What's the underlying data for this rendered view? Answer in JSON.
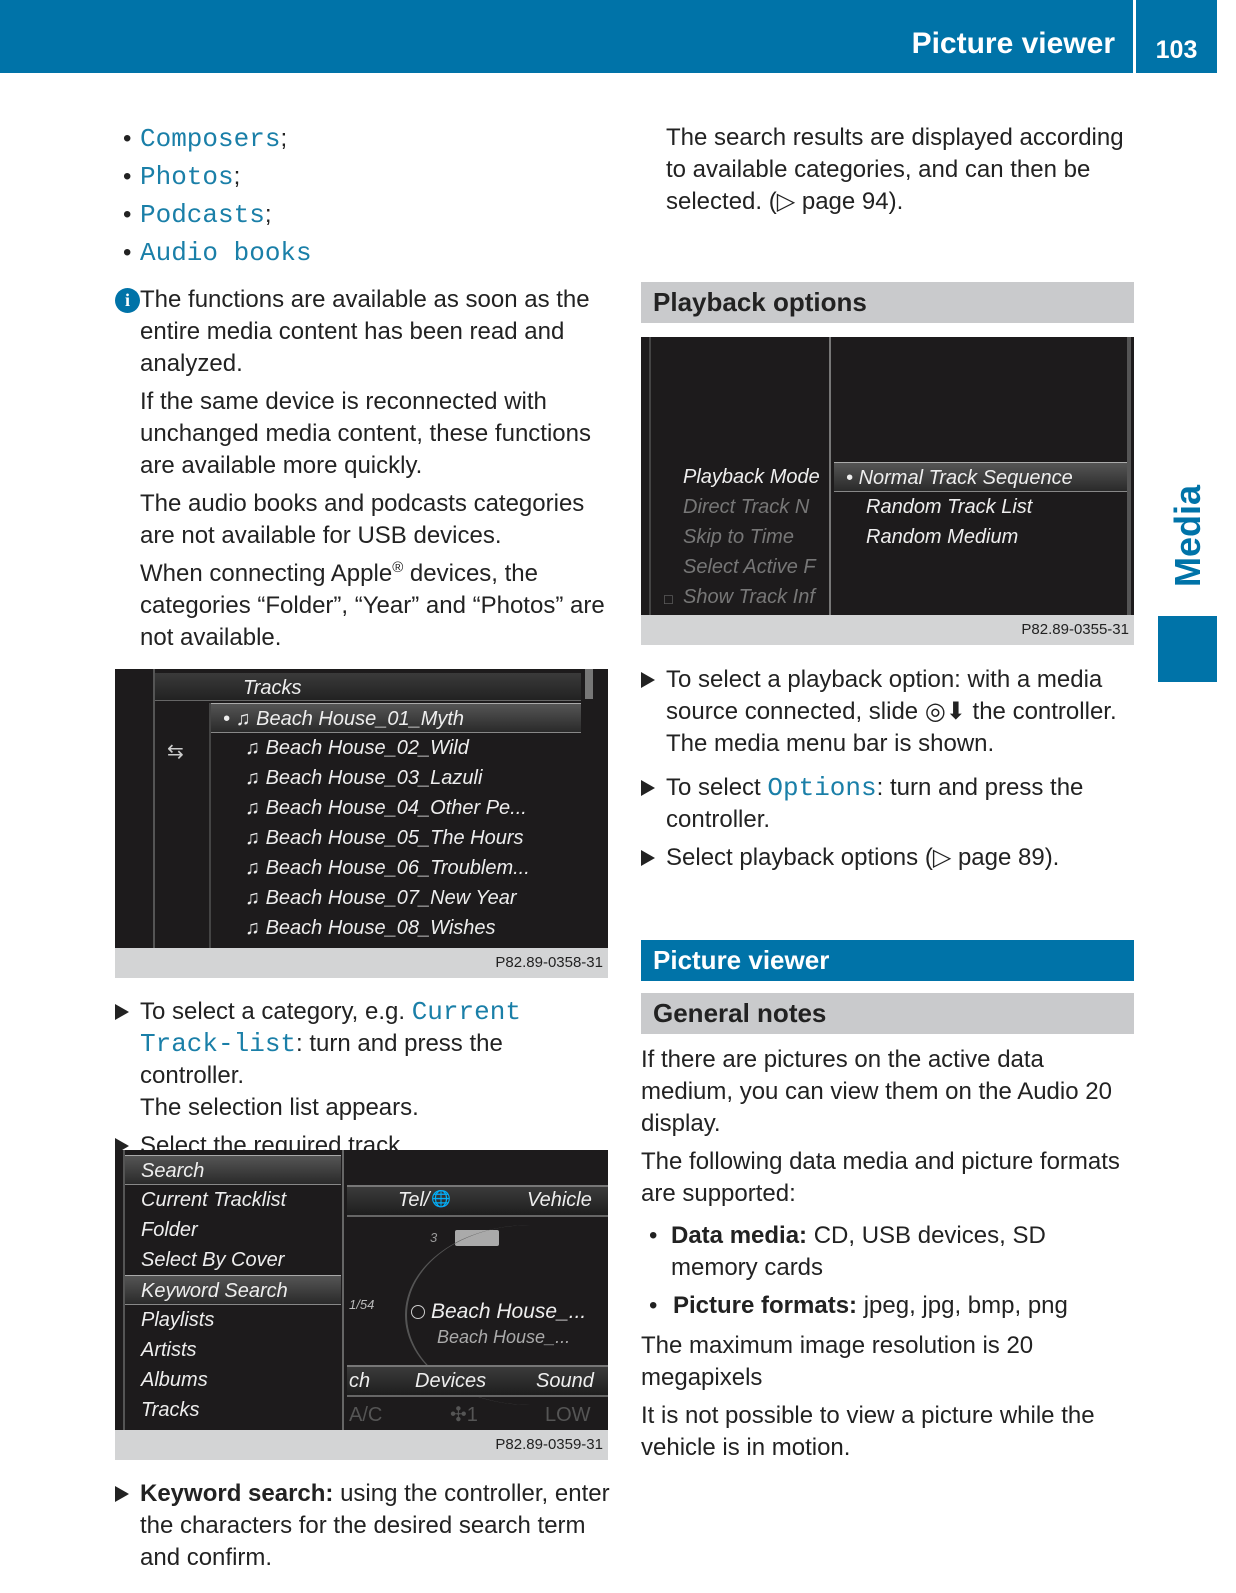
{
  "header": {
    "title": "Picture viewer",
    "page_number": "103"
  },
  "side_tab": {
    "label": "Media"
  },
  "left": {
    "bullets": [
      {
        "link": "Composers",
        "suffix": ";"
      },
      {
        "link": "Photos",
        "suffix": ";"
      },
      {
        "link": "Podcasts",
        "suffix": ";"
      },
      {
        "link": "Audio books",
        "suffix": ""
      }
    ],
    "info_paras": [
      "The functions are available as soon as the entire media content has been read and analyzed.",
      "If the same device is reconnected with unchanged media content, these functions are available more quickly.",
      "The audio books and podcasts categories are not available for USB devices."
    ],
    "apple_para": {
      "a": "When connecting Apple",
      "sup": "®",
      "b": " devices, the categories “Folder”, “Year” and “Photos” are not available."
    },
    "tracks_screen": {
      "title": "Tracks",
      "tracks": [
        "Beach House_01_Myth",
        "Beach House_02_Wild",
        "Beach House_03_Lazuli",
        "Beach House_04_Other Pe...",
        "Beach House_05_The Hours",
        "Beach House_06_Troublem...",
        "Beach House_07_New Year",
        "Beach House_08_Wishes"
      ],
      "selected_index": 0,
      "caption": "P82.89-0358-31"
    },
    "step1": {
      "a": "To select a category, e.g. ",
      "link": "Current Track-list",
      "b": ": turn and press the controller.",
      "c": "The selection list appears."
    },
    "step2": "Select the required track.",
    "search_screen": {
      "menu": [
        "Search",
        "Current Tracklist",
        "Folder",
        "Select By Cover",
        "Keyword Search",
        "Playlists",
        "Artists",
        "Albums",
        "Tracks"
      ],
      "selected": "Keyword Search",
      "top_bar": [
        "Tel/",
        "Vehicle"
      ],
      "device_num": "3",
      "track_count": "1/54",
      "track1": "Beach House_...",
      "track2": "Beach House_...",
      "bottom_bar": [
        "ch",
        "Devices",
        "Sound"
      ],
      "climate": [
        "A/C",
        "1",
        "LOW"
      ],
      "caption": "P82.89-0359-31"
    },
    "step3": {
      "bold": "Keyword search:",
      "text": " using the controller, enter the characters for the desired search term and confirm."
    }
  },
  "right": {
    "intro": "The search results are displayed according to available categories, and can then be selected. (▷ page 94).",
    "playback_heading": "Playback options",
    "playback_screen": {
      "left_menu": [
        "Playback Mode",
        "Direct Track N",
        "Skip to Time",
        "Select Active F",
        "Show Track Inf"
      ],
      "options": [
        "Normal Track Sequence",
        "Random Track List",
        "Random Medium"
      ],
      "selected": "Normal Track Sequence",
      "caption": "P82.89-0355-31"
    },
    "steps": [
      {
        "a": "To select a playback option: with a media source connected, slide ◎⬇ the controller.",
        "b": "The media menu bar is shown."
      },
      {
        "a": "To select ",
        "link": "Options",
        "b": ": turn and press the controller."
      },
      {
        "a": "Select playback options (▷ page 89)."
      }
    ],
    "picture_heading": "Picture viewer",
    "general_heading": "General notes",
    "p1": "If there are pictures on the active data medium, you can view them on the Audio 20 display.",
    "p2": "The following data media and picture formats are supported:",
    "list": [
      {
        "bold": "Data media:",
        "text": " CD, USB devices, SD memory cards"
      },
      {
        "bold": "Picture formats:",
        "text": " jpeg, jpg, bmp, png"
      }
    ],
    "p3": "The maximum image resolution is 20 megapixels",
    "p4": "It is not possible to view a picture while the vehicle is in motion."
  },
  "colors": {
    "brand_blue": "#0073a8",
    "link": "#1a7fa8",
    "section_grey": "#c9cacc"
  }
}
